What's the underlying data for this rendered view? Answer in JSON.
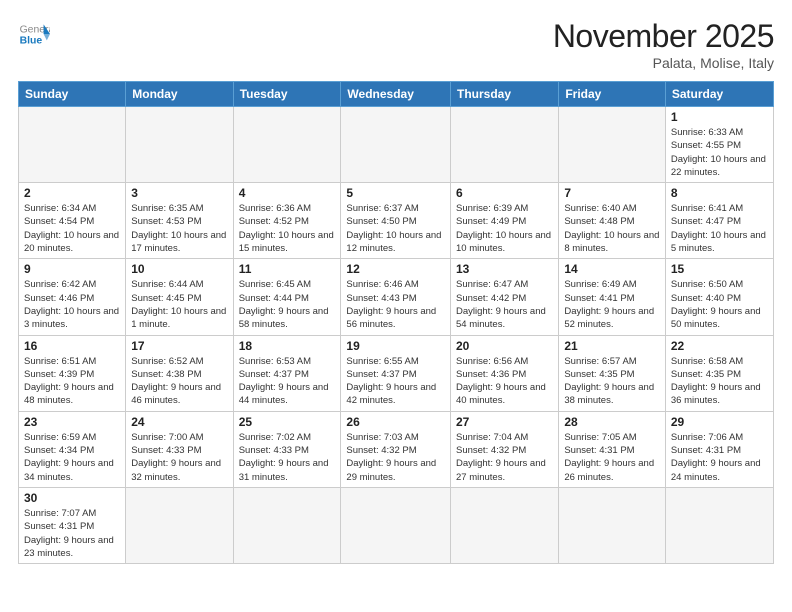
{
  "logo": {
    "general": "General",
    "blue": "Blue"
  },
  "title": "November 2025",
  "subtitle": "Palata, Molise, Italy",
  "weekdays": [
    "Sunday",
    "Monday",
    "Tuesday",
    "Wednesday",
    "Thursday",
    "Friday",
    "Saturday"
  ],
  "weeks": [
    [
      {
        "day": "",
        "info": ""
      },
      {
        "day": "",
        "info": ""
      },
      {
        "day": "",
        "info": ""
      },
      {
        "day": "",
        "info": ""
      },
      {
        "day": "",
        "info": ""
      },
      {
        "day": "",
        "info": ""
      },
      {
        "day": "1",
        "info": "Sunrise: 6:33 AM\nSunset: 4:55 PM\nDaylight: 10 hours and 22 minutes."
      }
    ],
    [
      {
        "day": "2",
        "info": "Sunrise: 6:34 AM\nSunset: 4:54 PM\nDaylight: 10 hours and 20 minutes."
      },
      {
        "day": "3",
        "info": "Sunrise: 6:35 AM\nSunset: 4:53 PM\nDaylight: 10 hours and 17 minutes."
      },
      {
        "day": "4",
        "info": "Sunrise: 6:36 AM\nSunset: 4:52 PM\nDaylight: 10 hours and 15 minutes."
      },
      {
        "day": "5",
        "info": "Sunrise: 6:37 AM\nSunset: 4:50 PM\nDaylight: 10 hours and 12 minutes."
      },
      {
        "day": "6",
        "info": "Sunrise: 6:39 AM\nSunset: 4:49 PM\nDaylight: 10 hours and 10 minutes."
      },
      {
        "day": "7",
        "info": "Sunrise: 6:40 AM\nSunset: 4:48 PM\nDaylight: 10 hours and 8 minutes."
      },
      {
        "day": "8",
        "info": "Sunrise: 6:41 AM\nSunset: 4:47 PM\nDaylight: 10 hours and 5 minutes."
      }
    ],
    [
      {
        "day": "9",
        "info": "Sunrise: 6:42 AM\nSunset: 4:46 PM\nDaylight: 10 hours and 3 minutes."
      },
      {
        "day": "10",
        "info": "Sunrise: 6:44 AM\nSunset: 4:45 PM\nDaylight: 10 hours and 1 minute."
      },
      {
        "day": "11",
        "info": "Sunrise: 6:45 AM\nSunset: 4:44 PM\nDaylight: 9 hours and 58 minutes."
      },
      {
        "day": "12",
        "info": "Sunrise: 6:46 AM\nSunset: 4:43 PM\nDaylight: 9 hours and 56 minutes."
      },
      {
        "day": "13",
        "info": "Sunrise: 6:47 AM\nSunset: 4:42 PM\nDaylight: 9 hours and 54 minutes."
      },
      {
        "day": "14",
        "info": "Sunrise: 6:49 AM\nSunset: 4:41 PM\nDaylight: 9 hours and 52 minutes."
      },
      {
        "day": "15",
        "info": "Sunrise: 6:50 AM\nSunset: 4:40 PM\nDaylight: 9 hours and 50 minutes."
      }
    ],
    [
      {
        "day": "16",
        "info": "Sunrise: 6:51 AM\nSunset: 4:39 PM\nDaylight: 9 hours and 48 minutes."
      },
      {
        "day": "17",
        "info": "Sunrise: 6:52 AM\nSunset: 4:38 PM\nDaylight: 9 hours and 46 minutes."
      },
      {
        "day": "18",
        "info": "Sunrise: 6:53 AM\nSunset: 4:37 PM\nDaylight: 9 hours and 44 minutes."
      },
      {
        "day": "19",
        "info": "Sunrise: 6:55 AM\nSunset: 4:37 PM\nDaylight: 9 hours and 42 minutes."
      },
      {
        "day": "20",
        "info": "Sunrise: 6:56 AM\nSunset: 4:36 PM\nDaylight: 9 hours and 40 minutes."
      },
      {
        "day": "21",
        "info": "Sunrise: 6:57 AM\nSunset: 4:35 PM\nDaylight: 9 hours and 38 minutes."
      },
      {
        "day": "22",
        "info": "Sunrise: 6:58 AM\nSunset: 4:35 PM\nDaylight: 9 hours and 36 minutes."
      }
    ],
    [
      {
        "day": "23",
        "info": "Sunrise: 6:59 AM\nSunset: 4:34 PM\nDaylight: 9 hours and 34 minutes."
      },
      {
        "day": "24",
        "info": "Sunrise: 7:00 AM\nSunset: 4:33 PM\nDaylight: 9 hours and 32 minutes."
      },
      {
        "day": "25",
        "info": "Sunrise: 7:02 AM\nSunset: 4:33 PM\nDaylight: 9 hours and 31 minutes."
      },
      {
        "day": "26",
        "info": "Sunrise: 7:03 AM\nSunset: 4:32 PM\nDaylight: 9 hours and 29 minutes."
      },
      {
        "day": "27",
        "info": "Sunrise: 7:04 AM\nSunset: 4:32 PM\nDaylight: 9 hours and 27 minutes."
      },
      {
        "day": "28",
        "info": "Sunrise: 7:05 AM\nSunset: 4:31 PM\nDaylight: 9 hours and 26 minutes."
      },
      {
        "day": "29",
        "info": "Sunrise: 7:06 AM\nSunset: 4:31 PM\nDaylight: 9 hours and 24 minutes."
      }
    ],
    [
      {
        "day": "30",
        "info": "Sunrise: 7:07 AM\nSunset: 4:31 PM\nDaylight: 9 hours and 23 minutes."
      },
      {
        "day": "",
        "info": ""
      },
      {
        "day": "",
        "info": ""
      },
      {
        "day": "",
        "info": ""
      },
      {
        "day": "",
        "info": ""
      },
      {
        "day": "",
        "info": ""
      },
      {
        "day": "",
        "info": ""
      }
    ]
  ]
}
